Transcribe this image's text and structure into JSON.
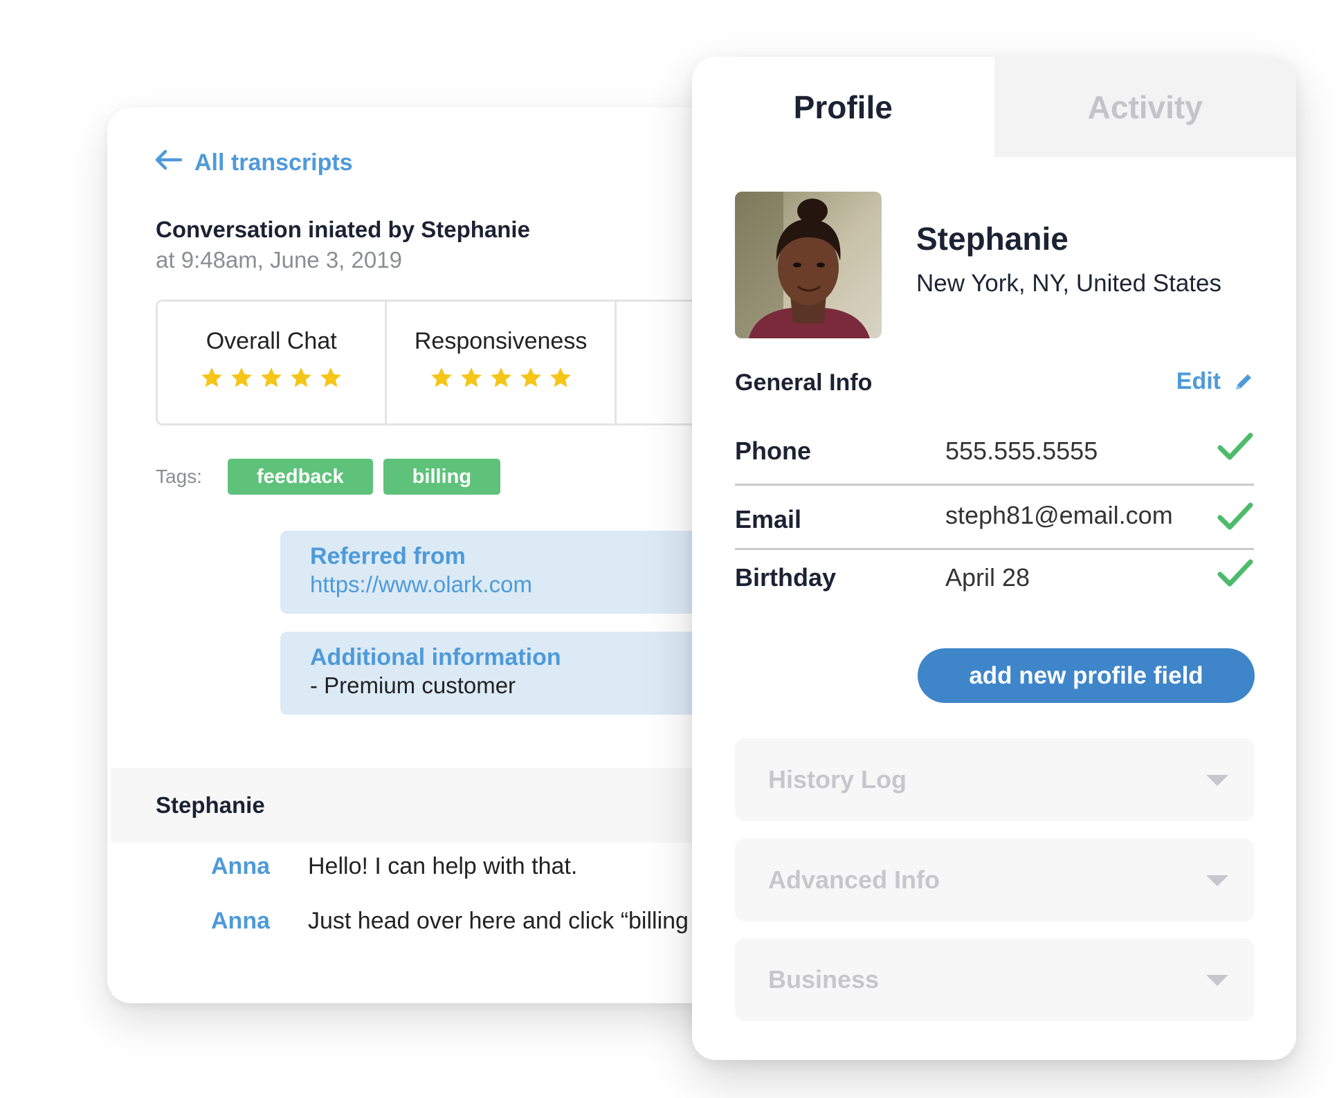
{
  "transcript": {
    "back_label": "All transcripts",
    "title": "Conversation iniated by Stephanie",
    "subtitle": "at 9:48am, June 3, 2019",
    "ratings": [
      {
        "label": "Overall Chat",
        "stars": 5
      },
      {
        "label": "Responsiveness",
        "stars": 5
      }
    ],
    "tags_label": "Tags:",
    "tags": [
      "feedback",
      "billing"
    ],
    "referred": {
      "heading": "Referred from",
      "url": "https://www.olark.com"
    },
    "additional": {
      "heading": "Additional information",
      "text": "- Premium customer"
    },
    "chat_header": "Stephanie",
    "messages": [
      {
        "author": "Anna",
        "text": "Hello! I can help with that."
      },
      {
        "author": "Anna",
        "text": "Just head over here and click “billing"
      }
    ]
  },
  "profile": {
    "tabs": [
      {
        "label": "Profile",
        "active": true
      },
      {
        "label": "Activity",
        "active": false
      }
    ],
    "name": "Stephanie",
    "location": "New York, NY, United States",
    "general_info_title": "General Info",
    "edit_label": "Edit",
    "fields": [
      {
        "label": "Phone",
        "value": "555.555.5555",
        "verified": true
      },
      {
        "label": "Email",
        "value": "steph81@email.com",
        "verified": true
      },
      {
        "label": "Birthday",
        "value": "April 28",
        "verified": true
      }
    ],
    "add_field_label": "add new profile field",
    "accordions": [
      "History Log",
      "Advanced Info",
      "Business"
    ]
  },
  "colors": {
    "accent_blue": "#4e9ad9",
    "button_blue": "#3f85c9",
    "tag_green": "#5fc27b",
    "check_green": "#4dbb6a",
    "star_yellow": "#f5c518",
    "info_bg": "#dceaf6"
  },
  "icons": {
    "back": "arrow-left-icon",
    "edit": "pencil-icon",
    "verified": "check-icon",
    "accordion": "chevron-down-icon",
    "rating": "star-icon"
  }
}
